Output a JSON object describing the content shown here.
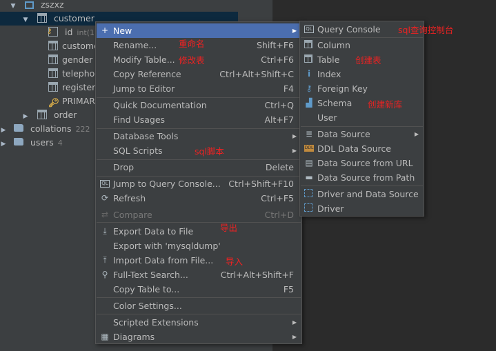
{
  "tree": {
    "schema_name": "zszxz",
    "table_customer": "customer",
    "columns": [
      {
        "name": "id",
        "type": "int(11"
      },
      {
        "name": "custome"
      },
      {
        "name": "gender"
      },
      {
        "name": "telephor"
      },
      {
        "name": "register_"
      },
      {
        "name": "PRIMAR"
      }
    ],
    "table_order": "order",
    "collations": {
      "label": "collations",
      "count": "222"
    },
    "users": {
      "label": "users",
      "count": "4"
    }
  },
  "context_menu": {
    "items": [
      {
        "label": "New",
        "shortcut": ""
      },
      {
        "label": "Rename...",
        "shortcut": "Shift+F6"
      },
      {
        "label": "Modify Table...",
        "shortcut": "Ctrl+F6"
      },
      {
        "label": "Copy Reference",
        "shortcut": "Ctrl+Alt+Shift+C"
      },
      {
        "label": "Jump to Editor",
        "shortcut": "F4"
      },
      {
        "label": "Quick Documentation",
        "shortcut": "Ctrl+Q"
      },
      {
        "label": "Find Usages",
        "shortcut": "Alt+F7"
      },
      {
        "label": "Database Tools",
        "shortcut": ""
      },
      {
        "label": "SQL Scripts",
        "shortcut": ""
      },
      {
        "label": "Drop",
        "shortcut": "Delete"
      },
      {
        "label": "Jump to Query Console...",
        "shortcut": "Ctrl+Shift+F10"
      },
      {
        "label": "Refresh",
        "shortcut": "Ctrl+F5"
      },
      {
        "label": "Compare",
        "shortcut": "Ctrl+D"
      },
      {
        "label": "Export Data to File",
        "shortcut": ""
      },
      {
        "label": "Export with 'mysqldump'",
        "shortcut": ""
      },
      {
        "label": "Import Data from File...",
        "shortcut": ""
      },
      {
        "label": "Full-Text Search...",
        "shortcut": "Ctrl+Alt+Shift+F"
      },
      {
        "label": "Copy Table to...",
        "shortcut": "F5"
      },
      {
        "label": "Color Settings...",
        "shortcut": ""
      },
      {
        "label": "Scripted Extensions",
        "shortcut": ""
      },
      {
        "label": "Diagrams",
        "shortcut": ""
      }
    ]
  },
  "submenu_new": {
    "items": [
      {
        "label": "Query Console",
        "icon": "console-icon"
      },
      {
        "label": "Column",
        "icon": "column-icon"
      },
      {
        "label": "Table",
        "icon": "table-icon"
      },
      {
        "label": "Index",
        "icon": "index-icon"
      },
      {
        "label": "Foreign Key",
        "icon": "foreign-key-icon"
      },
      {
        "label": "Schema",
        "icon": "schema-icon"
      },
      {
        "label": "User",
        "icon": "user-icon"
      },
      {
        "label": "Data Source",
        "icon": "data-source-icon"
      },
      {
        "label": "DDL Data Source",
        "icon": "ddl-icon"
      },
      {
        "label": "Data Source from URL",
        "icon": "url-icon"
      },
      {
        "label": "Data Source from Path",
        "icon": "folder-icon"
      },
      {
        "label": "Driver and Data Source",
        "icon": "driver-icon"
      },
      {
        "label": "Driver",
        "icon": "driver-icon"
      }
    ]
  },
  "annotations": {
    "rename": "重命名",
    "modify": "修改表",
    "sql_scripts": "sql脚本",
    "export": "导出",
    "import": "导入",
    "query_console": "sql查询控制台",
    "create_table": "创建表",
    "create_schema": "创建新库"
  },
  "colors": {
    "highlight": "#4b6eaf",
    "annotation": "#ee2222",
    "panel": "#3c3f41"
  }
}
